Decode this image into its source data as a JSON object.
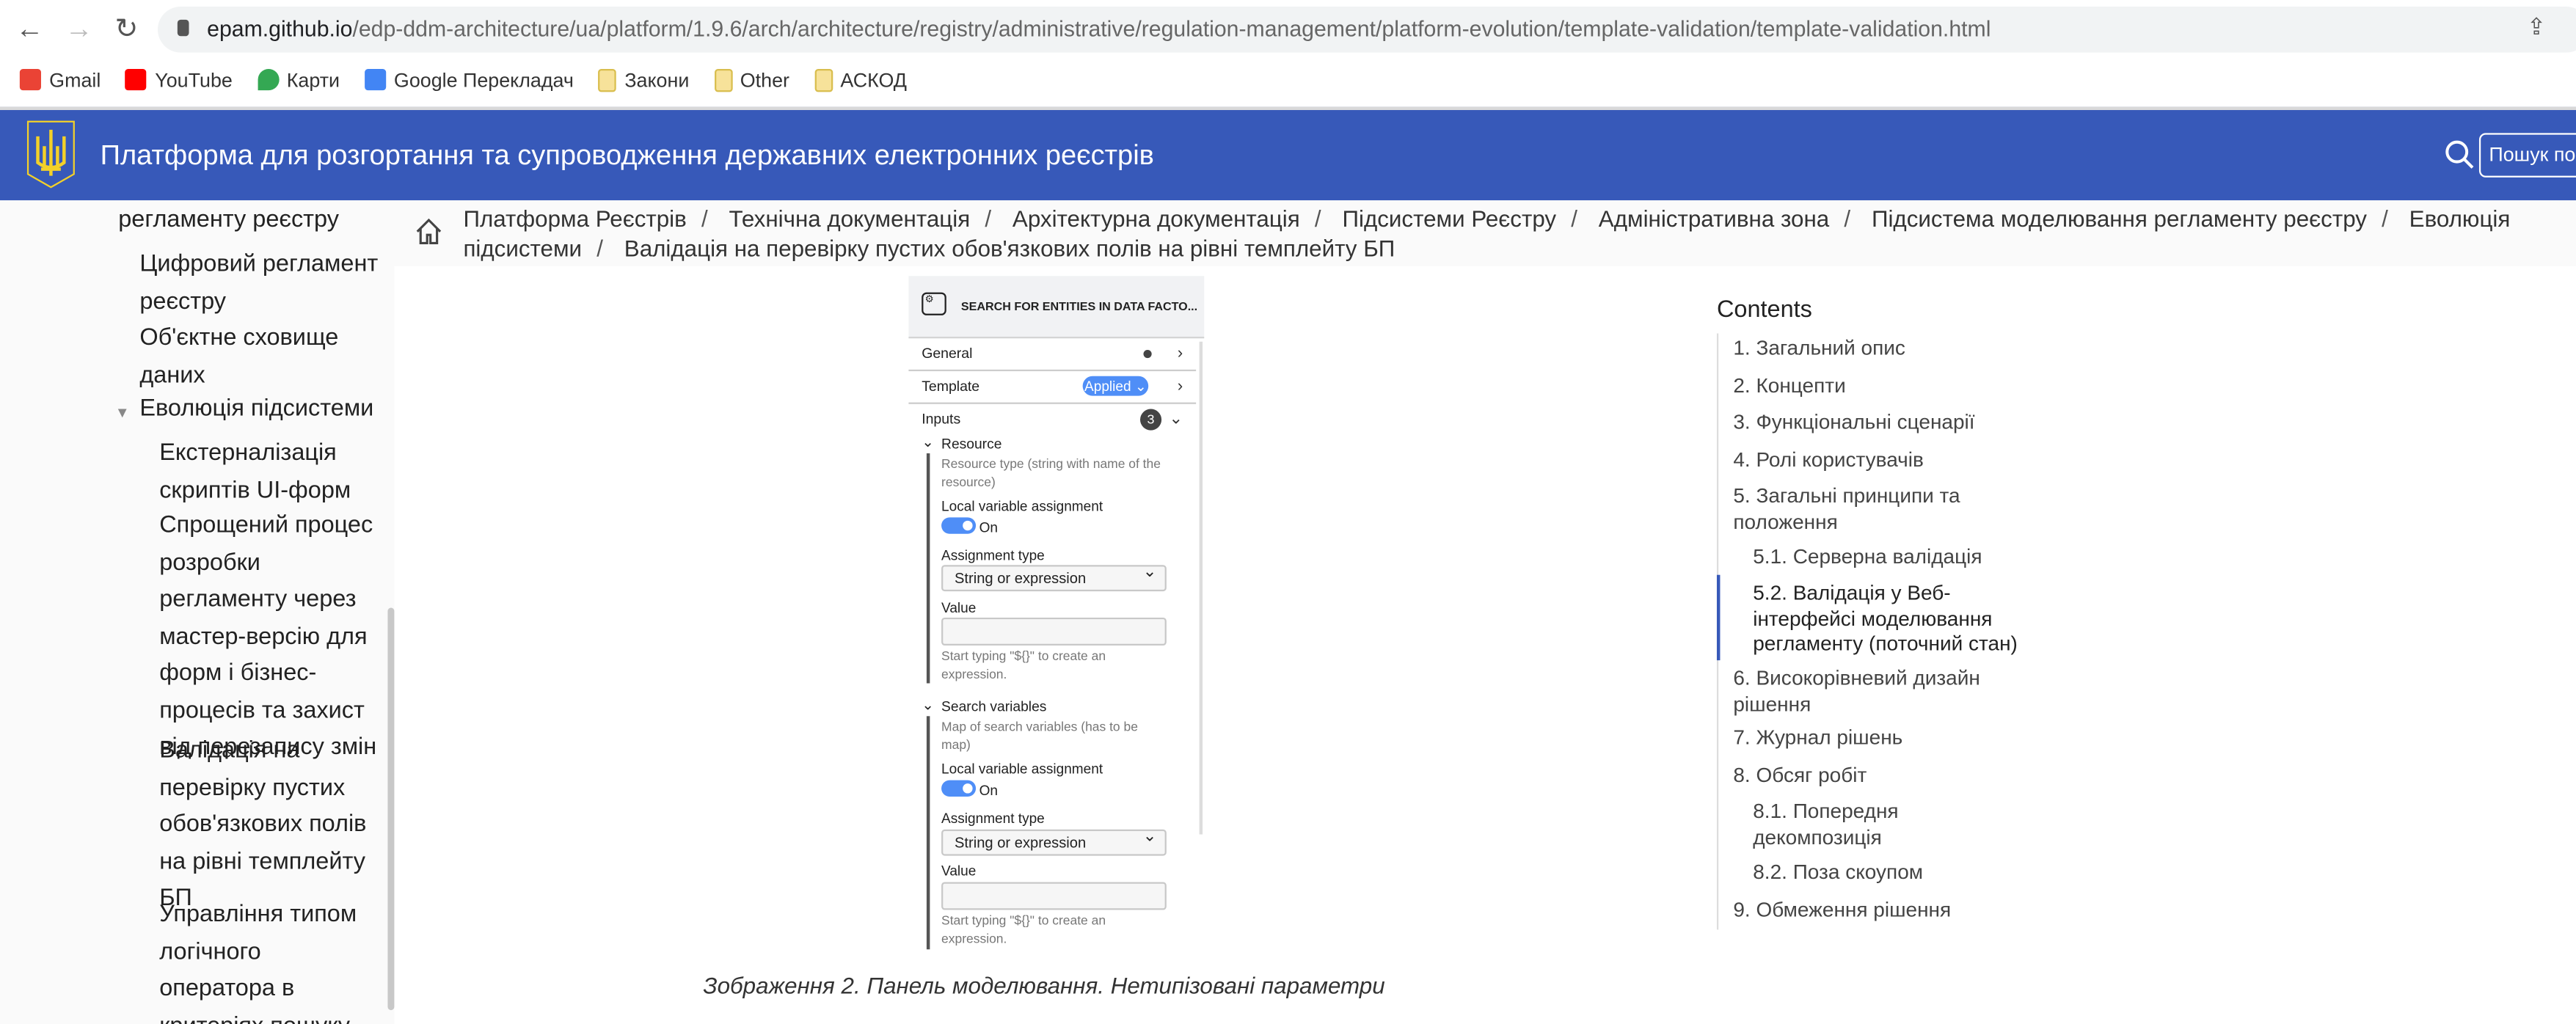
{
  "browser": {
    "url_host": "epam.github.io",
    "url_path": "/edp-ddm-architecture/ua/platform/1.9.6/arch/architecture/registry/administrative/regulation-management/platform-evolution/template-validation/template-validation.html",
    "bookmarks": [
      {
        "label": "Gmail",
        "icon": "gmail-icon",
        "color": "#ea4335"
      },
      {
        "label": "YouTube",
        "icon": "youtube-icon",
        "color": "#ff0000"
      },
      {
        "label": "Карти",
        "icon": "maps-icon",
        "color": "#34a853"
      },
      {
        "label": "Google Перекладач",
        "icon": "translate-icon",
        "color": "#4285f4"
      },
      {
        "label": "Закони",
        "icon": "folder-icon"
      },
      {
        "label": "Other",
        "icon": "folder-icon"
      },
      {
        "label": "АСКОД",
        "icon": "folder-icon"
      }
    ]
  },
  "header": {
    "title": "Платформа для розгортання та супроводження державних електронних реєстрів",
    "search_placeholder": "Пошук по документації",
    "color": "#3759b9"
  },
  "sidebar": {
    "items": [
      "регламенту реєстру",
      "Цифровий регламент\nреєстру",
      "Об'єктне сховище\nданих",
      "Еволюція підсистеми",
      "Екстерналізація\nскриптів UI-форм",
      "Спрощений процес\nрозробки\nрегламенту через\nмастер-версію для\nформ і бізнес-\nпроцесів та захист\nвід перезапису змін",
      "Валідація на\nперевірку пустих\nобов'язкових полів\nна рівні темплейту\nБП",
      "Управління типом\nлогічного\nоператора в\nкритеріях пошуку"
    ]
  },
  "breadcrumbs": [
    "Платформа Реєстрів",
    "Технічна документація",
    "Архітектурна документація",
    "Підсистеми Реєстру",
    "Адміністративна зона",
    "Підсистема моделювання регламенту реєстру",
    "Еволюція підсистеми",
    "Валідація на перевірку пустих обов'язкових полів на рівні темплейту БП"
  ],
  "figure": {
    "title": "SEARCH FOR ENTITIES IN DATA FACTO...",
    "general": "General",
    "template": "Template",
    "template_badge": "Applied",
    "inputs": "Inputs",
    "inputs_count": "3",
    "groups": [
      {
        "name": "Resource",
        "desc": "Resource type (string with name of the\nresource)",
        "local_label": "Local variable assignment",
        "toggle": "On",
        "type_label": "Assignment type",
        "type_value": "String or expression",
        "value_label": "Value",
        "hint": "Start typing \"${}\" to create an\nexpression."
      },
      {
        "name": "Search variables",
        "desc": "Map of search variables (has to be\nmap)",
        "local_label": "Local variable assignment",
        "toggle": "On",
        "type_label": "Assignment type",
        "type_value": "String or expression",
        "value_label": "Value",
        "hint": "Start typing \"${}\" to create an\nexpression."
      }
    ],
    "accent": "#4f8ef7"
  },
  "caption": "Зображення 2. Панель моделювання. Нетипізовані параметри",
  "toc": {
    "title": "Contents",
    "items": [
      {
        "label": "1. Загальний опис"
      },
      {
        "label": "2. Концепти"
      },
      {
        "label": "3. Функціональні сценарії"
      },
      {
        "label": "4. Ролі користувачів"
      },
      {
        "label": "5. Загальні принципи та\nположення"
      },
      {
        "label": "5.1. Серверна валідація"
      },
      {
        "label": "5.2. Валідація у Веб-\nінтерфейсі моделювання\nрегламенту (поточний стан)",
        "active": true
      },
      {
        "label": "6. Високорівневий дизайн\nрішення"
      },
      {
        "label": "7. Журнал рішень"
      },
      {
        "label": "8. Обсяг робіт"
      },
      {
        "label": "8.1. Попередня\nдекомпозиція"
      },
      {
        "label": "8.2. Поза скоупом"
      },
      {
        "label": "9. Обмеження рішення"
      }
    ]
  }
}
